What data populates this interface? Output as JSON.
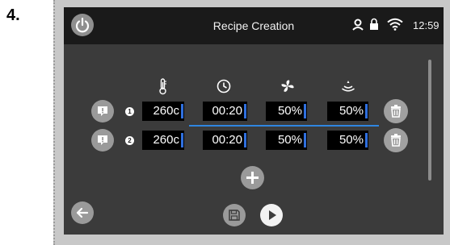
{
  "step_label": "4.",
  "header": {
    "title": "Recipe Creation",
    "clock": "12:59",
    "icons": [
      "power-icon",
      "user-icon",
      "lock-icon",
      "wifi-icon"
    ]
  },
  "columns": {
    "icons": [
      "thermometer-icon",
      "timer-icon",
      "fan-icon",
      "humidity-icon"
    ]
  },
  "steps": [
    {
      "number": "1",
      "temperature": "260c",
      "time": "00:20",
      "fan": "50%",
      "humidity": "50%"
    },
    {
      "number": "2",
      "temperature": "260c",
      "time": "00:20",
      "fan": "50%",
      "humidity": "50%"
    }
  ],
  "controls": {
    "icons": [
      "add-icon",
      "back-arrow-icon",
      "save-icon",
      "play-icon",
      "delete-icon",
      "alert-icon"
    ]
  },
  "colors": {
    "screen_bg": "#3b3b3b",
    "topbar_bg": "#1a1a1a",
    "accent_blue": "#2f6fde",
    "button_gray": "#9a9a9a"
  }
}
